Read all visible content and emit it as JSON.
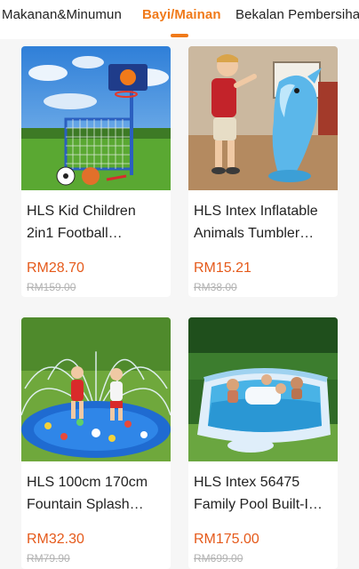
{
  "tabs": [
    {
      "label": "Makanan&Minumun",
      "active": false
    },
    {
      "label": "Bayi/Mainan",
      "active": true
    },
    {
      "label": "Bekalan Pembersiha",
      "active": false
    }
  ],
  "colors": {
    "accent": "#f07a1a",
    "price": "#e55a1b",
    "old_price": "#b3b3b3"
  },
  "products": [
    {
      "name_line1": "HLS Kid Children",
      "name_line2": "2in1 Football…",
      "price": "RM28.70",
      "original_price": "RM159.00",
      "image": "football-basketball-goal-set"
    },
    {
      "name_line1": "HLS Intex Inflatable",
      "name_line2": "Animals Tumbler…",
      "price": "RM15.21",
      "original_price": "RM38.00",
      "image": "inflatable-dolphin-tumbler"
    },
    {
      "name_line1": "HLS 100cm 170cm",
      "name_line2": "Fountain Splash…",
      "price": "RM32.30",
      "original_price": "RM79.90",
      "image": "splash-pad-mat"
    },
    {
      "name_line1": "HLS Intex 56475",
      "name_line2": "Family Pool Built-I…",
      "price": "RM175.00",
      "original_price": "RM699.00",
      "image": "family-inflatable-pool"
    }
  ]
}
